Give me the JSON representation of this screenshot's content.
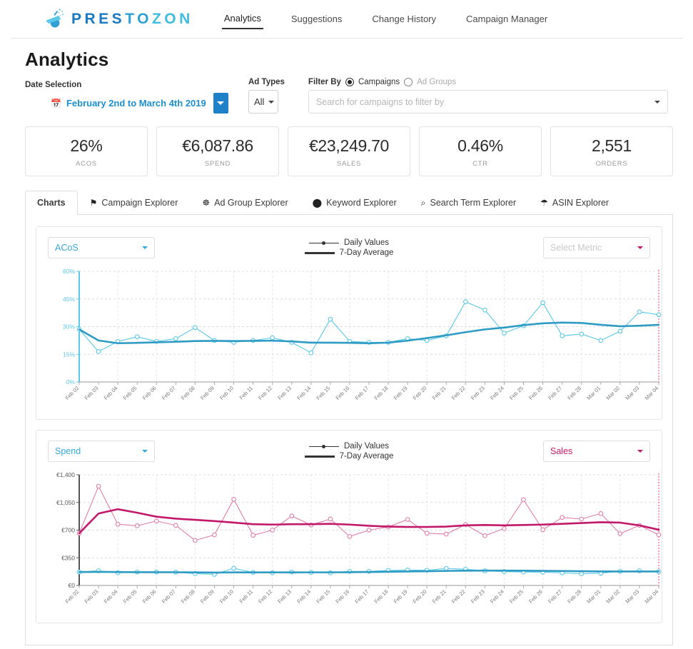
{
  "brand": {
    "name_parts": [
      "PRES",
      "TO",
      "ZON"
    ],
    "logo_icon": "spray-bottle-icon"
  },
  "nav": {
    "items": [
      {
        "label": "Analytics",
        "active": true
      },
      {
        "label": "Suggestions",
        "active": false
      },
      {
        "label": "Change History",
        "active": false
      },
      {
        "label": "Campaign Manager",
        "active": false
      }
    ]
  },
  "page": {
    "title": "Analytics"
  },
  "filters": {
    "date_label": "Date Selection",
    "date_value": "February 2nd to March 4th 2019",
    "ad_types_label": "Ad Types",
    "ad_types_value": "All",
    "filter_by_label": "Filter By",
    "radio_campaigns": "Campaigns",
    "radio_ad_groups": "Ad Groups",
    "search_placeholder": "Search for campaigns to filter by"
  },
  "kpis": [
    {
      "value": "26%",
      "label": "ACOS"
    },
    {
      "value": "€6,087.86",
      "label": "SPEND"
    },
    {
      "value": "€23,249.70",
      "label": "SALES"
    },
    {
      "value": "0.46%",
      "label": "CTR"
    },
    {
      "value": "2,551",
      "label": "ORDERS"
    }
  ],
  "tabs": [
    {
      "label": "Charts",
      "icon": "",
      "active": true
    },
    {
      "label": "Campaign Explorer",
      "icon": "⚑",
      "active": false
    },
    {
      "label": "Ad Group Explorer",
      "icon": "☸",
      "active": false
    },
    {
      "label": "Keyword Explorer",
      "icon": "⬤",
      "active": false
    },
    {
      "label": "Search Term Explorer",
      "icon": "⌕",
      "active": false
    },
    {
      "label": "ASIN Explorer",
      "icon": "☂",
      "active": false
    }
  ],
  "legend": {
    "daily": "Daily Values",
    "average": "7-Day Average"
  },
  "chart1_controls": {
    "left_metric": "ACoS",
    "right_metric": "Select Metric"
  },
  "chart2_controls": {
    "left_metric": "Spend",
    "right_metric": "Sales"
  },
  "colors": {
    "primary_blue": "#1f82c8",
    "light_blue": "#5bc8e8",
    "dark_blue": "#2e9bc4",
    "pink": "#c2186a",
    "light_pink": "#e07fa8",
    "marker_line": "#f2a0bb"
  },
  "chart_data": [
    {
      "type": "line",
      "title": "ACoS",
      "xlabel": "",
      "ylabel": "ACoS",
      "ylim": [
        0,
        60
      ],
      "yticks": [
        "0%",
        "15%",
        "30%",
        "45%",
        "60%"
      ],
      "grid": true,
      "legend_position": "top-center",
      "x": [
        "Feb 02",
        "Feb 03",
        "Feb 04",
        "Feb 05",
        "Feb 06",
        "Feb 07",
        "Feb 08",
        "Feb 09",
        "Feb 10",
        "Feb 11",
        "Feb 12",
        "Feb 13",
        "Feb 14",
        "Feb 15",
        "Feb 16",
        "Feb 17",
        "Feb 18",
        "Feb 19",
        "Feb 20",
        "Feb 21",
        "Feb 22",
        "Feb 23",
        "Feb 24",
        "Feb 25",
        "Feb 26",
        "Feb 27",
        "Feb 28",
        "Mar 01",
        "Mar 02",
        "Mar 03",
        "Mar 04"
      ],
      "series": [
        {
          "name": "Daily Values",
          "color": "#5bc8e8",
          "markers": true,
          "values": [
            28.5,
            16.5,
            22.0,
            24.5,
            22.0,
            23.5,
            29.5,
            22.5,
            21.5,
            22.5,
            24.0,
            21.5,
            15.8,
            34.0,
            22.0,
            21.5,
            21.5,
            23.5,
            22.5,
            25.0,
            43.5,
            39.0,
            26.5,
            30.5,
            43.0,
            25.0,
            26.0,
            22.5,
            27.5,
            38.0,
            36.5
          ]
        },
        {
          "name": "7-Day Average",
          "color": "#2e9bc4",
          "markers": false,
          "values": [
            28.5,
            22.5,
            21.0,
            21.2,
            21.5,
            21.8,
            22.2,
            22.3,
            22.2,
            22.3,
            22.4,
            22.0,
            21.3,
            21.3,
            21.2,
            21.0,
            21.3,
            22.4,
            23.8,
            25.3,
            27.0,
            28.5,
            29.5,
            30.8,
            31.8,
            32.2,
            32.0,
            31.0,
            30.2,
            30.5,
            31.0
          ]
        }
      ]
    },
    {
      "type": "line",
      "title": "Spend & Sales",
      "xlabel": "",
      "ylabel": "Euro",
      "ylim": [
        0,
        1400
      ],
      "yticks": [
        "€0",
        "€350",
        "€700",
        "€1,050",
        "€1,400"
      ],
      "grid": true,
      "legend_position": "top-center",
      "x": [
        "Feb 02",
        "Feb 03",
        "Feb 04",
        "Feb 05",
        "Feb 06",
        "Feb 07",
        "Feb 08",
        "Feb 09",
        "Feb 10",
        "Feb 11",
        "Feb 12",
        "Feb 13",
        "Feb 14",
        "Feb 15",
        "Feb 16",
        "Feb 17",
        "Feb 18",
        "Feb 19",
        "Feb 20",
        "Feb 21",
        "Feb 22",
        "Feb 23",
        "Feb 24",
        "Feb 25",
        "Feb 26",
        "Feb 27",
        "Feb 28",
        "Mar 01",
        "Mar 02",
        "Mar 03",
        "Mar 04"
      ],
      "series": [
        {
          "name": "Sales Daily Values",
          "color": "#e07fa8",
          "markers": true,
          "values": [
            660,
            1255,
            775,
            755,
            815,
            760,
            570,
            640,
            1090,
            635,
            700,
            880,
            765,
            840,
            620,
            700,
            740,
            835,
            660,
            650,
            770,
            630,
            720,
            1085,
            705,
            860,
            840,
            910,
            655,
            760,
            640
          ]
        },
        {
          "name": "Sales 7-Day Average",
          "color": "#c2186a",
          "markers": false,
          "values": [
            660,
            910,
            965,
            920,
            870,
            845,
            830,
            815,
            795,
            775,
            770,
            775,
            775,
            780,
            770,
            755,
            745,
            740,
            740,
            745,
            760,
            765,
            760,
            765,
            770,
            780,
            790,
            800,
            795,
            760,
            705
          ]
        },
        {
          "name": "Spend Daily Values",
          "color": "#5bc8e8",
          "markers": true,
          "values": [
            170,
            185,
            160,
            170,
            170,
            168,
            150,
            140,
            218,
            165,
            160,
            170,
            165,
            160,
            178,
            178,
            190,
            195,
            192,
            215,
            205,
            185,
            175,
            170,
            168,
            160,
            148,
            155,
            180,
            185,
            175
          ]
        },
        {
          "name": "Spend 7-Day Average",
          "color": "#2e9bc4",
          "markers": false,
          "values": [
            170,
            172,
            170,
            168,
            168,
            167,
            165,
            163,
            165,
            165,
            165,
            165,
            166,
            166,
            168,
            170,
            173,
            177,
            180,
            184,
            187,
            188,
            188,
            187,
            185,
            183,
            180,
            178,
            177,
            177,
            177
          ]
        }
      ]
    }
  ]
}
